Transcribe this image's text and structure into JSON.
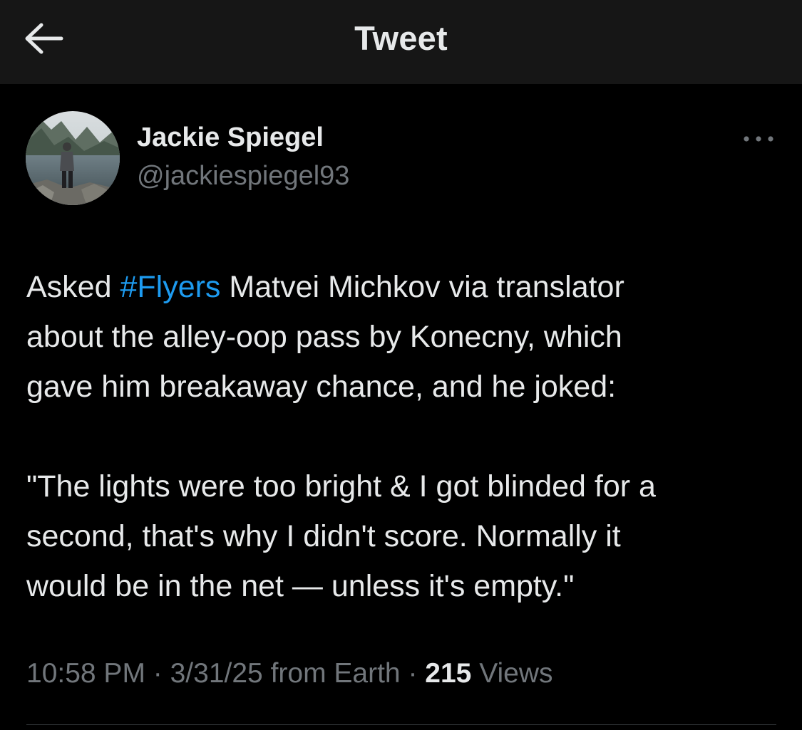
{
  "header": {
    "title": "Tweet",
    "back_icon": "arrow-left-icon",
    "background": "#161616"
  },
  "author": {
    "display_name": "Jackie Spiegel",
    "handle": "@jackiespiegel93",
    "avatar_icon": "profile-photo-lake-mountains"
  },
  "more_icon": "more-horizontal-icon",
  "tweet": {
    "text_before_hashtag": "Asked ",
    "hashtag": "#Flyers",
    "text_after_hashtag": " Matvei Michkov via translator\nabout the alley-oop pass by Konecny, which\ngave him breakaway chance, and he joked:\n\n\"The lights were too bright & I got blinded for a\nsecond, that's why I didn't score. Normally it\nwould be in the net — unless it's empty.\""
  },
  "meta": {
    "time": "10:58 PM",
    "separator": " · ",
    "date": "3/31/25",
    "source": " from Earth",
    "views_count": "215",
    "views_label": " Views"
  },
  "colors": {
    "background": "#000000",
    "text": "#e7e9ea",
    "secondary_text": "#71767b",
    "accent": "#1d9bf0"
  }
}
